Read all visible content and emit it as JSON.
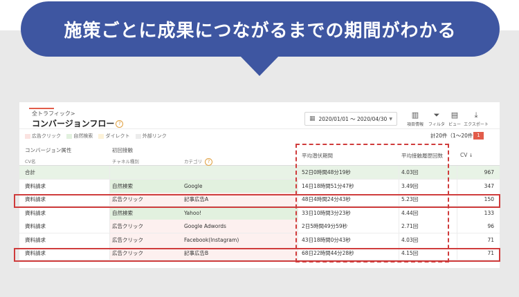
{
  "headline": "施策ごとに成果につながるまでの期間がわかる",
  "breadcrumb": "全トラフィック>",
  "title": "コンバージョンフロー",
  "help_glyph": "?",
  "date_range": "2020/01/01 ～ 2020/04/30",
  "toolbar": [
    {
      "label": "項目情報",
      "icon": "columns-icon",
      "glyph": "▥"
    },
    {
      "label": "フィルタ",
      "icon": "filter-icon",
      "glyph": "⏷"
    },
    {
      "label": "ビュー",
      "icon": "view-icon",
      "glyph": "▤"
    },
    {
      "label": "エクスポート",
      "icon": "download-icon",
      "glyph": "⤓"
    }
  ],
  "legend": [
    {
      "label": "広告クリック",
      "color": "#fbe3e1"
    },
    {
      "label": "自然検索",
      "color": "#e2f1df"
    },
    {
      "label": "ダイレクト",
      "color": "#fdf2d8"
    },
    {
      "label": "外部リンク",
      "color": "#ececec"
    }
  ],
  "count": "計20件（1〜20件）",
  "page": "1",
  "columns": {
    "cv_attr": "コンバージョン属性",
    "first_touch": "初回接触",
    "cv_name": "CV名",
    "channel": "チャネル種別",
    "category": "カテゴリ",
    "period": "平均潜伏期間",
    "touch_count": "平均接触履歴回数",
    "cv": "CV",
    "sort_glyph": "↓"
  },
  "rows": [
    {
      "cv_name": "合計",
      "channel": "",
      "category": "",
      "period": "52日0時間48分19秒",
      "touches": "4.03回",
      "cv": "967",
      "type": "total"
    },
    {
      "cv_name": "資料請求",
      "channel": "自然検索",
      "category": "Google",
      "period": "14日18時間51分47秒",
      "touches": "3.49回",
      "cv": "347",
      "type": "organic"
    },
    {
      "cv_name": "資料請求",
      "channel": "広告クリック",
      "category": "記事広告A",
      "period": "48日4時間24分43秒",
      "touches": "5.23回",
      "cv": "150",
      "type": "ad"
    },
    {
      "cv_name": "資料請求",
      "channel": "自然検索",
      "category": "Yahoo!",
      "period": "33日10時間3分23秒",
      "touches": "4.44回",
      "cv": "133",
      "type": "organic"
    },
    {
      "cv_name": "資料請求",
      "channel": "広告クリック",
      "category": "Google Adwords",
      "period": "2日5時間49分59秒",
      "touches": "2.71回",
      "cv": "96",
      "type": "ad"
    },
    {
      "cv_name": "資料請求",
      "channel": "広告クリック",
      "category": "Facebook(Instagram)",
      "period": "43日18時間0分43秒",
      "touches": "4.03回",
      "cv": "71",
      "type": "ad"
    },
    {
      "cv_name": "資料請求",
      "channel": "広告クリック",
      "category": "記事広告B",
      "period": "68日22時間44分28秒",
      "touches": "4.15回",
      "cv": "71",
      "type": "ad"
    }
  ],
  "colors": {
    "accent_blue": "#3e56a1",
    "highlight_red": "#cf3b3b",
    "total_row": "#e8f3e6",
    "organic": "#e2f1df",
    "ad": "#fdf0ef"
  }
}
